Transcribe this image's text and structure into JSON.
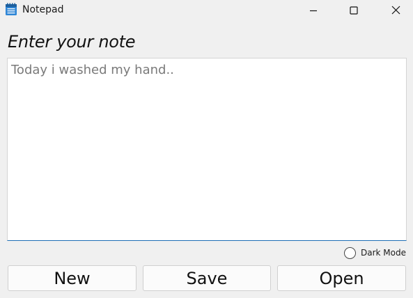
{
  "window": {
    "title": "Notepad",
    "app_icon": "notepad-icon",
    "controls": {
      "minimize_icon": "minimize-icon",
      "maximize_icon": "maximize-icon",
      "close_icon": "close-icon"
    }
  },
  "main": {
    "heading": "Enter your note",
    "note": {
      "placeholder": "Today i washed my hand.."
    },
    "dark_mode": {
      "label": "Dark Mode",
      "checked": false
    }
  },
  "buttons": {
    "new_label": "New",
    "save_label": "Save",
    "open_label": "Open"
  },
  "colors": {
    "background": "#f0f0f0",
    "focus_border": "#1f6fb5",
    "icon_blue": "#2f86d6"
  }
}
